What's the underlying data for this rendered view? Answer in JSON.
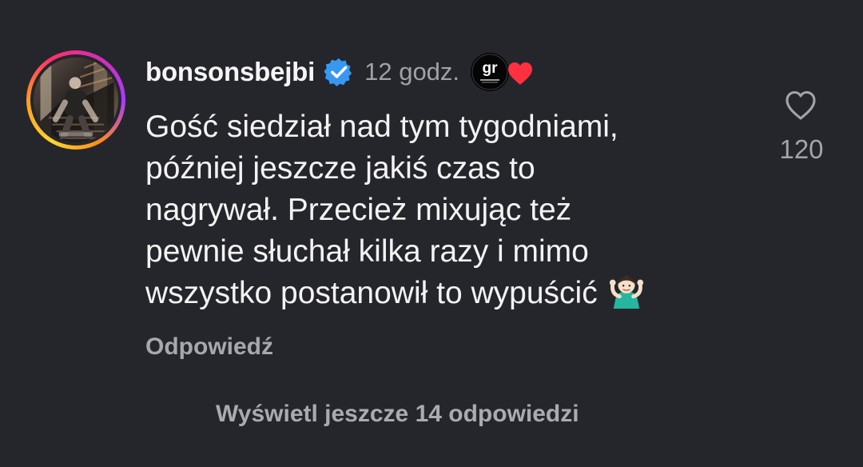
{
  "comment": {
    "username": "bonsonsbejbi",
    "time": "12 godz.",
    "text_lines": [
      "Gość siedział nad tym tygodniami,",
      "później jeszcze jakiś czas to",
      "nagrywał. Przecież mixując też",
      "pewnie słuchał kilka razy i mimo",
      "wszystko postanowił to wypuścić"
    ],
    "reply_label": "Odpowiedź",
    "like_count": "120",
    "view_more_label": "Wyświetl jeszcze 14 odpowiedzi",
    "creator_badge_text": "gr"
  },
  "icons": {
    "verified": "verified-badge-icon",
    "creator_heart": "creator-heart-icon",
    "like": "heart-outline-icon",
    "emoji": "person-shrugging-emoji"
  },
  "colors": {
    "background": "#25262b",
    "verified": "#3897f0",
    "heart": "#ff3040",
    "muted_text": "#a6a8ad",
    "primary_text": "#f3f3f3"
  }
}
